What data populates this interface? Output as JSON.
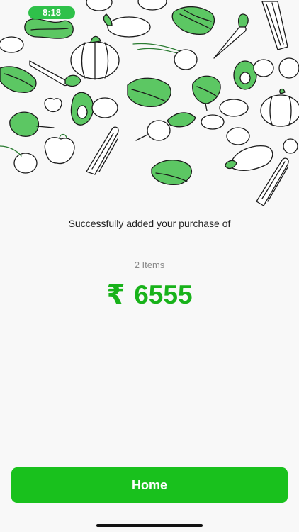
{
  "status_bar": {
    "time": "8:18"
  },
  "confirmation": {
    "message": "Successfully added your purchase of",
    "items_count": "2 Items",
    "currency_symbol": "₹",
    "amount": "6555"
  },
  "actions": {
    "home_label": "Home"
  },
  "colors": {
    "accent_green": "#19c11d",
    "amount_green": "#18b21a",
    "illustration_green": "#52c45a"
  }
}
